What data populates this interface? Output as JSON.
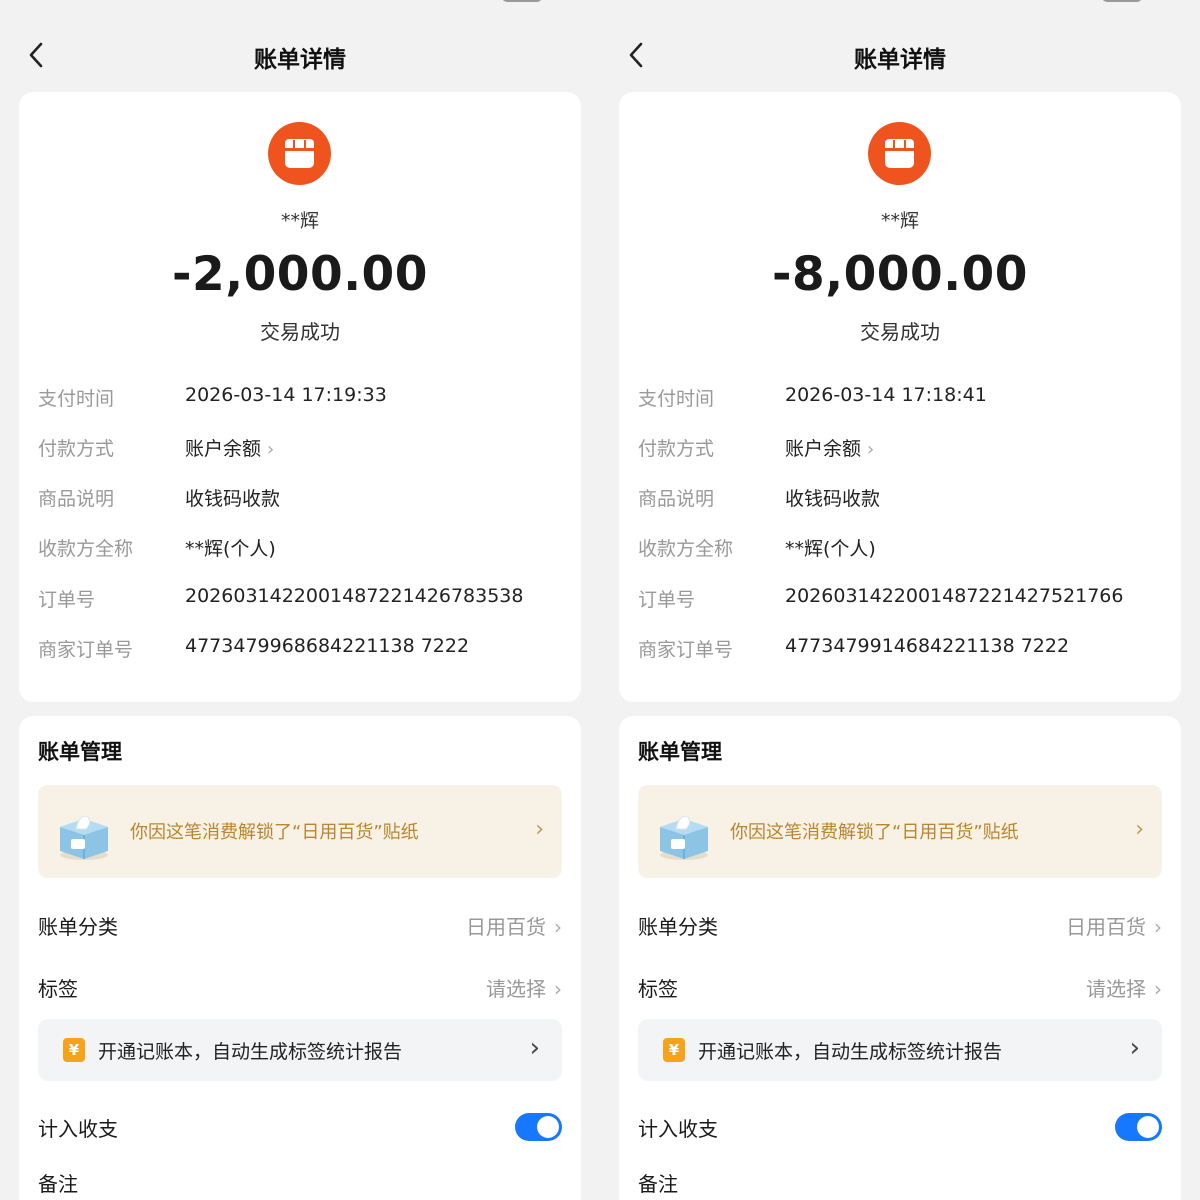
{
  "screens": [
    {
      "nav": {
        "title": "账单详情"
      },
      "detail": {
        "payee": "**辉",
        "amount": "-2,000.00",
        "status": "交易成功",
        "rows": [
          {
            "label": "支付时间",
            "value": "2026-03-14 17:19:33"
          },
          {
            "label": "付款方式",
            "value": "账户余额"
          },
          {
            "label": "商品说明",
            "value": "收钱码收款"
          },
          {
            "label": "收款方全称",
            "value": "**辉(个人)"
          },
          {
            "label": "订单号",
            "value": "2026031422001487221426783538"
          },
          {
            "label": "商家订单号",
            "value": "4773479968684221138 7222"
          }
        ]
      },
      "manage": {
        "title": "账单管理",
        "sticker_text": "你因这笔消费解锁了“日用百货”贴纸",
        "category_label": "账单分类",
        "category_value": "日用百货",
        "tag_label": "标签",
        "tag_value": "请选择",
        "ledger_text": "开通记账本，自动生成标签统计报告",
        "count_label": "计入收支",
        "count_on": true,
        "note_label": "备注"
      }
    },
    {
      "nav": {
        "title": "账单详情"
      },
      "detail": {
        "payee": "**辉",
        "amount": "-8,000.00",
        "status": "交易成功",
        "rows": [
          {
            "label": "支付时间",
            "value": "2026-03-14 17:18:41"
          },
          {
            "label": "付款方式",
            "value": "账户余额"
          },
          {
            "label": "商品说明",
            "value": "收钱码收款"
          },
          {
            "label": "收款方全称",
            "value": "**辉(个人)"
          },
          {
            "label": "订单号",
            "value": "2026031422001487221427521766"
          },
          {
            "label": "商家订单号",
            "value": "4773479914684221138 7222"
          }
        ]
      },
      "manage": {
        "title": "账单管理",
        "sticker_text": "你因这笔消费解锁了“日用百货”贴纸",
        "category_label": "账单分类",
        "category_value": "日用百货",
        "tag_label": "标签",
        "tag_value": "请选择",
        "ledger_text": "开通记账本，自动生成标签统计报告",
        "count_label": "计入收支",
        "count_on": true,
        "note_label": "备注"
      }
    }
  ],
  "icons": {
    "back": "chevron-left-icon",
    "merchant": "store-icon",
    "sticker": "tissue-box-sticker-icon",
    "ledger": "yen-icon",
    "chevron": "chevron-right-icon"
  },
  "colors": {
    "merchant_icon": "#f0541e",
    "toggle_on": "#1677ff",
    "sticker_banner_bg": "#f8f1e6",
    "sticker_text": "#b8862e",
    "ledger_icon": "#f7a21b"
  }
}
